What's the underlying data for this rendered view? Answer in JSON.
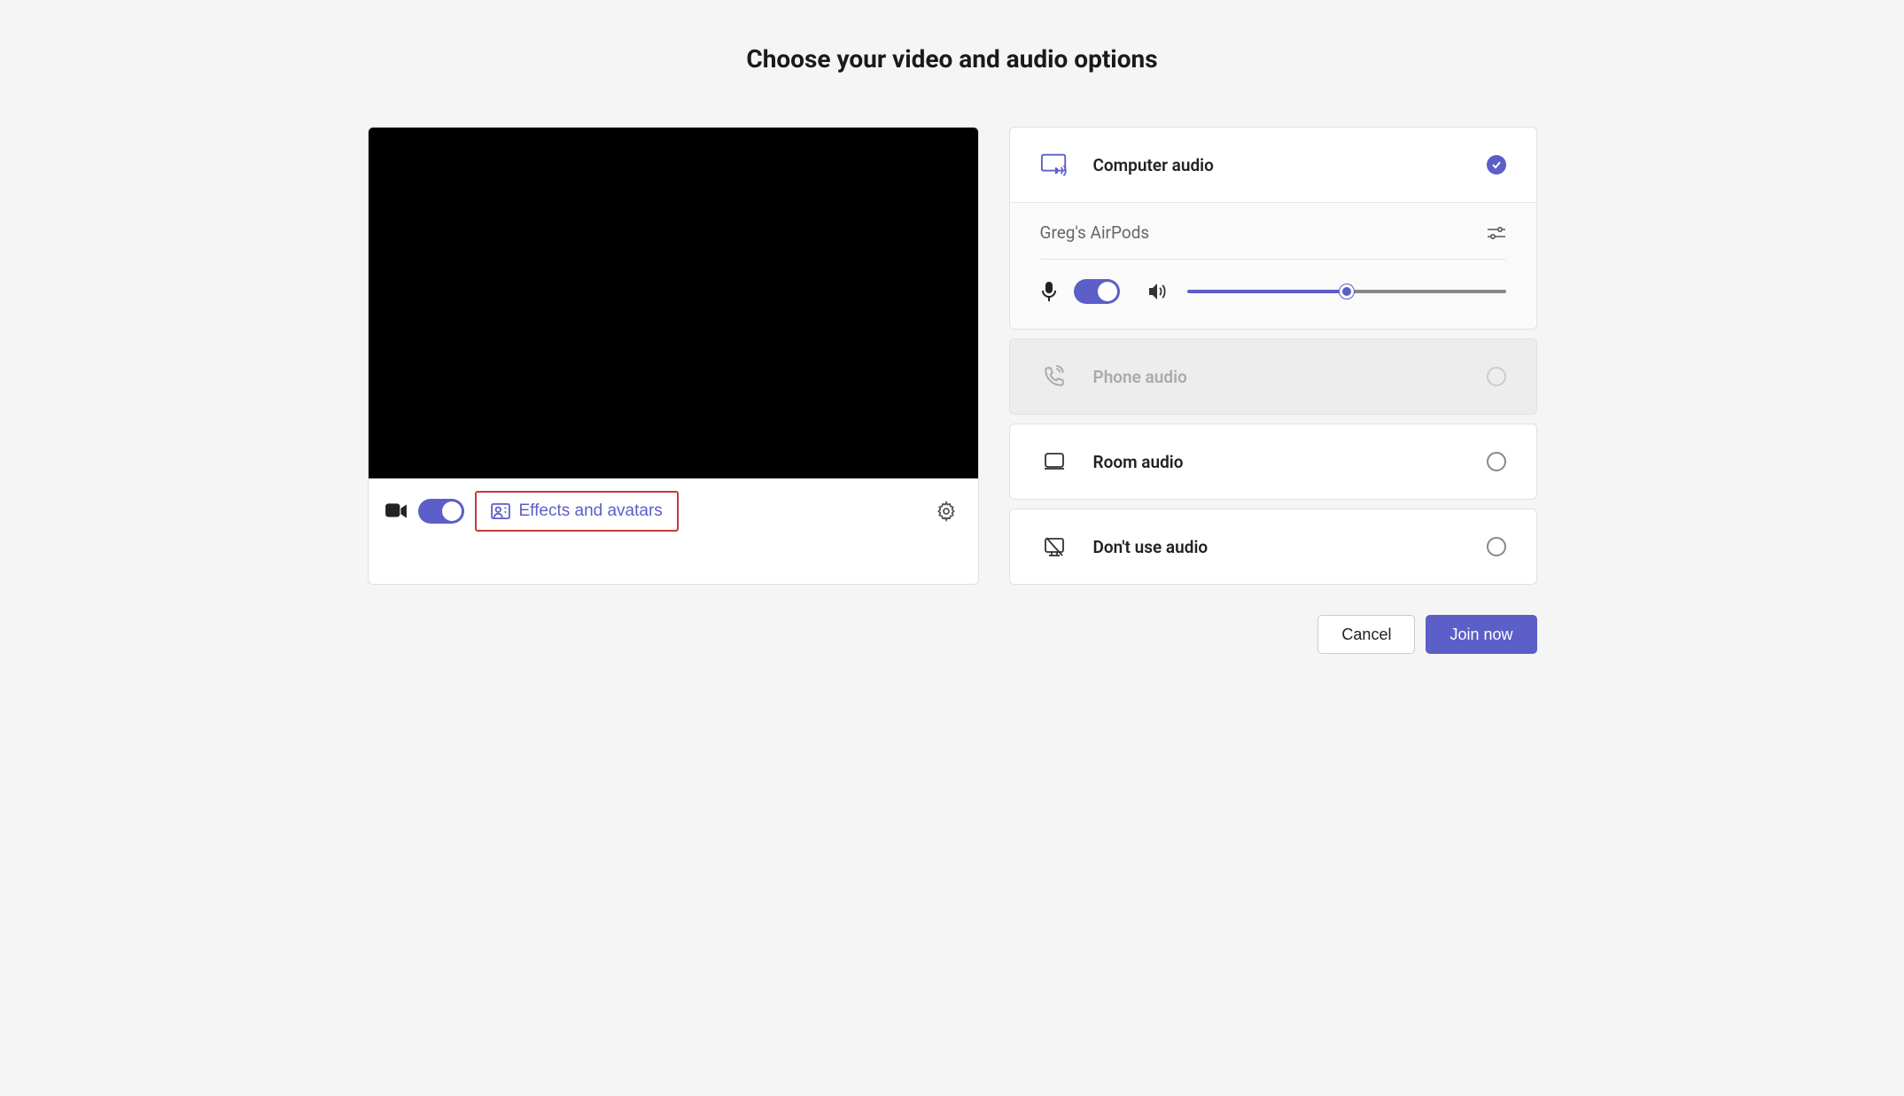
{
  "title": "Choose your video and audio options",
  "video": {
    "camera_on": true,
    "effects_label": "Effects and avatars"
  },
  "audio": {
    "computer": {
      "label": "Computer audio",
      "selected": true,
      "device": "Greg's AirPods",
      "mic_on": true,
      "volume_percent": 50
    },
    "phone": {
      "label": "Phone audio",
      "enabled": false
    },
    "room": {
      "label": "Room audio"
    },
    "none": {
      "label": "Don't use audio"
    }
  },
  "footer": {
    "cancel": "Cancel",
    "join": "Join now"
  },
  "colors": {
    "accent": "#5b5fc7",
    "highlight_border": "#c23b3b"
  }
}
